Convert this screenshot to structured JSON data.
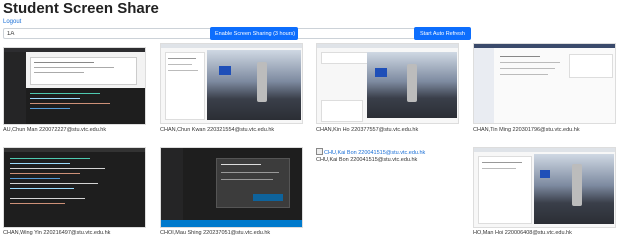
{
  "page": {
    "title": "Student Screen Share",
    "logout_label": "Logout",
    "class_value": "1A",
    "share_button_label": "Enable Screen Sharing (3 hours)",
    "refresh_button_label": "Start Auto Refresh"
  },
  "students": [
    {
      "caption": "AU,Chun Man 220072227@stu.vtc.edu.hk",
      "screen": "code-editor-light"
    },
    {
      "caption": "CHAN,Chun Kwan 220321554@stu.vtc.edu.hk",
      "screen": "video-call"
    },
    {
      "caption": "CHAN,Kin Ho 220377557@stu.vtc.edu.hk",
      "screen": "video-call"
    },
    {
      "caption": "CHAN,Tin Ming 220301796@stu.vtc.edu.hk",
      "screen": "settings-page"
    },
    {
      "caption": "CHAN,Wing Yin 220216497@stu.vtc.edu.hk",
      "screen": "code-editor-dark"
    },
    {
      "caption": "CHOI,Mau Shing 220237051@stu.vtc.edu.hk",
      "screen": "dialog-dark"
    },
    {
      "caption": "CHU,Kai Bon 220041515@stu.vtc.edu.hk",
      "screen": "broken-image",
      "alt": "CHU,Kai Bon 220041515@stu.vtc.edu.hk"
    },
    {
      "caption": "HO,Man Hoi 220006408@stu.vtc.edu.hk",
      "screen": "video-call-portrait"
    }
  ],
  "colors": {
    "primary": "#0d6efd",
    "link": "#1a6fd6"
  }
}
